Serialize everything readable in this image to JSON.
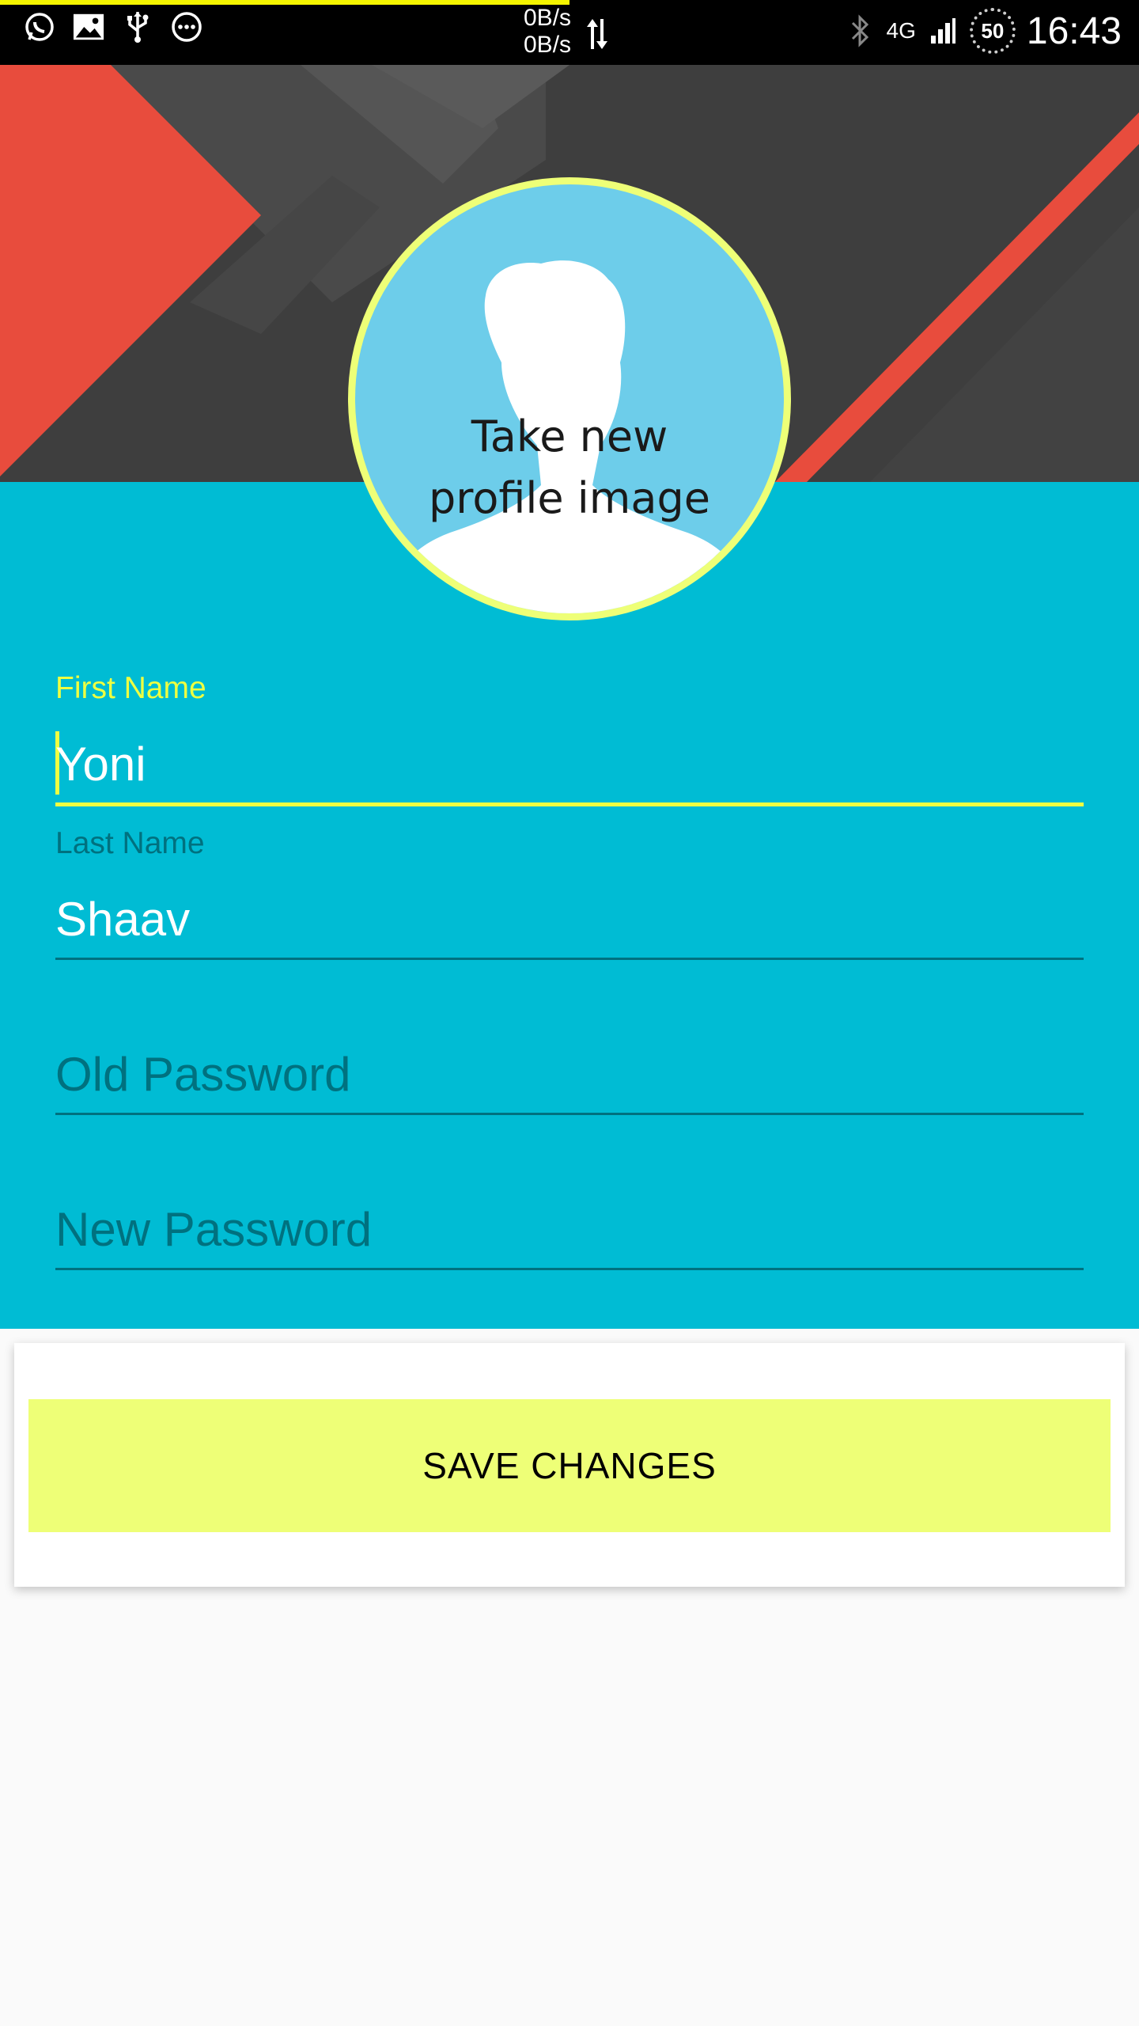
{
  "status_bar": {
    "net_up": "0B/s",
    "net_down": "0B/s",
    "network_type": "4G",
    "battery_level": "50",
    "time": "16:43",
    "left_icons": [
      "whatsapp-icon",
      "gallery-icon",
      "usb-icon",
      "more-icon"
    ],
    "right_icons": [
      "bluetooth-icon",
      "signal-icon",
      "battery-icon"
    ],
    "progress_fraction": 0.5
  },
  "profile": {
    "caption_line1": "Take new",
    "caption_line2": "profile image"
  },
  "form": {
    "first_name": {
      "label": "First Name",
      "value": "Yoni"
    },
    "last_name": {
      "label": "Last Name",
      "value": "Shaav"
    },
    "old_password": {
      "placeholder": "Old Password"
    },
    "new_password": {
      "placeholder": "New Password"
    }
  },
  "actions": {
    "save_label": "SAVE CHANGES"
  },
  "colors": {
    "accent": "#eeff41",
    "form_background": "#00bcd4",
    "banner_dark": "#3f3f3f",
    "banner_red": "#e84c3d",
    "button": "#eeff77"
  }
}
